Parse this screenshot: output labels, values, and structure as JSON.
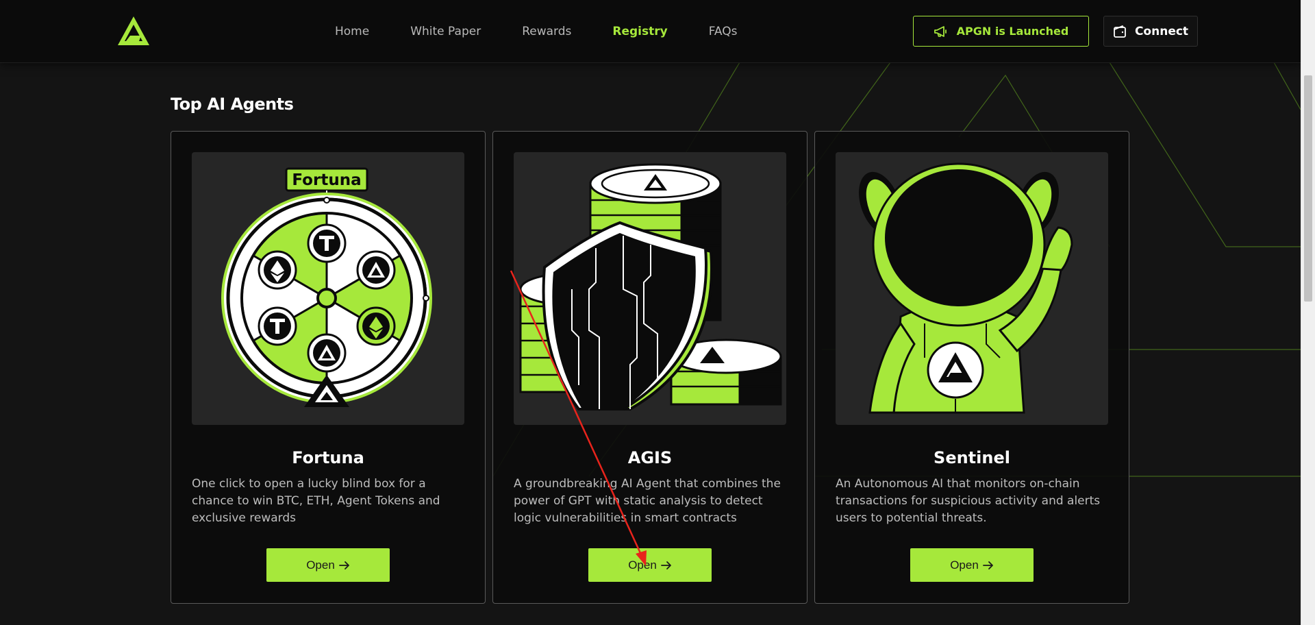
{
  "header": {
    "logo_icon": "apgn-logo-icon",
    "nav": [
      {
        "label": "Home",
        "active": false
      },
      {
        "label": "White Paper",
        "active": false
      },
      {
        "label": "Rewards",
        "active": false
      },
      {
        "label": "Registry",
        "active": true
      },
      {
        "label": "FAQs",
        "active": false
      }
    ],
    "launch_button": {
      "label": "APGN is Launched",
      "icon": "megaphone-icon"
    },
    "connect_button": {
      "label": "Connect",
      "icon": "wallet-icon"
    }
  },
  "section": {
    "title": "Top AI Agents"
  },
  "agents": [
    {
      "name": "Fortuna",
      "art_label": "Fortuna",
      "description": "One click to open a lucky blind box for a chance to win BTC, ETH, Agent Tokens and exclusive rewards",
      "button_label": "Open",
      "button_icon": "arrow-right-icon"
    },
    {
      "name": "AGIS",
      "description": "A groundbreaking AI Agent that combines the power of GPT with static analysis to detect logic vulnerabilities in smart contracts",
      "button_label": "Open",
      "button_icon": "arrow-right-icon"
    },
    {
      "name": "Sentinel",
      "description": "An Autonomous AI that monitors on-chain transactions for suspicious activity and alerts users to potential threats.",
      "button_label": "Open",
      "button_icon": "arrow-right-icon"
    }
  ],
  "colors": {
    "accent": "#a6e83b",
    "background": "#141414",
    "card_border": "#5a5a5a",
    "annotation_arrow": "#e8241c"
  }
}
